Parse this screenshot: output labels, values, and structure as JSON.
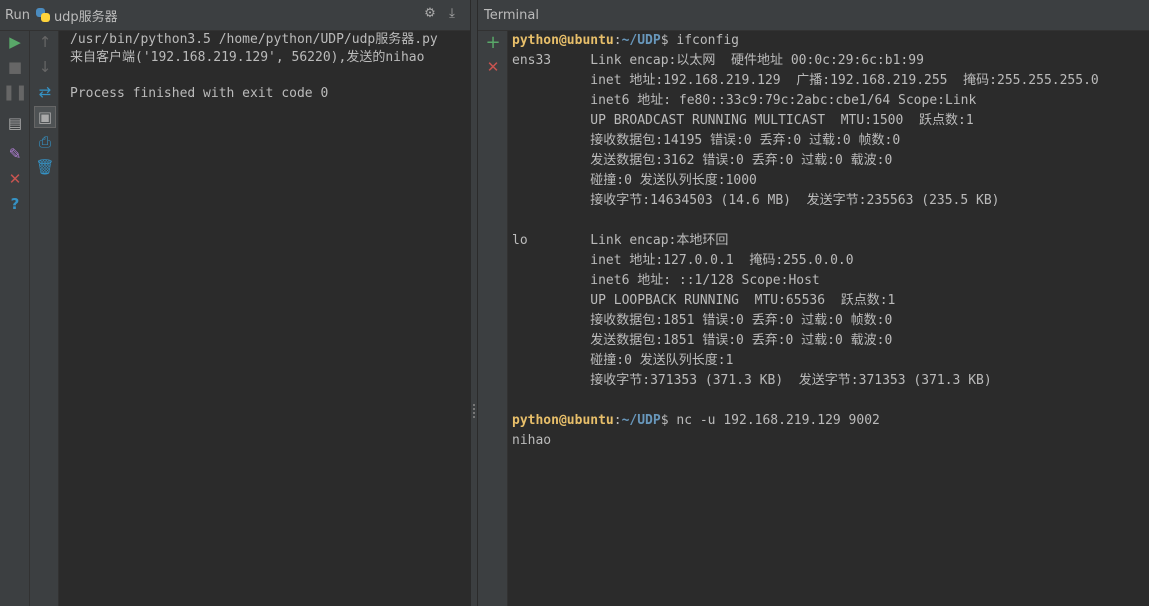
{
  "run_panel": {
    "title": "Run",
    "tab_name": "udp服务器",
    "header_icons": [
      "gear-icon",
      "hide-icon"
    ],
    "output_lines": [
      "/usr/bin/python3.5 /home/python/UDP/udp服务器.py",
      "来自客户端('192.168.219.129', 56220),发送的nihao",
      "",
      "Process finished with exit code 0"
    ],
    "left_toolbar": [
      "run-icon",
      "stop-icon",
      "pause-icon",
      "layout-icon",
      "pin-icon",
      "close-icon",
      "help-icon"
    ],
    "right_toolbar": [
      "up-arrow-icon",
      "down-arrow-icon",
      "soft-wrap-icon",
      "scroll-to-end-icon",
      "print-icon",
      "trash-icon"
    ]
  },
  "terminal": {
    "title": "Terminal",
    "toolbar": [
      "add-icon",
      "close-icon"
    ],
    "prompt1": {
      "user": "python@ubuntu",
      "sep": ":",
      "path": "~/UDP",
      "symbol": "$ ",
      "command": "ifconfig"
    },
    "ifconfig_lines": [
      "ens33     Link encap:以太网  硬件地址 00:0c:29:6c:b1:99",
      "          inet 地址:192.168.219.129  广播:192.168.219.255  掩码:255.255.255.0",
      "          inet6 地址: fe80::33c9:79c:2abc:cbe1/64 Scope:Link",
      "          UP BROADCAST RUNNING MULTICAST  MTU:1500  跃点数:1",
      "          接收数据包:14195 错误:0 丢弃:0 过载:0 帧数:0",
      "          发送数据包:3162 错误:0 丢弃:0 过载:0 载波:0",
      "          碰撞:0 发送队列长度:1000",
      "          接收字节:14634503 (14.6 MB)  发送字节:235563 (235.5 KB)",
      "",
      "lo        Link encap:本地环回",
      "          inet 地址:127.0.0.1  掩码:255.0.0.0",
      "          inet6 地址: ::1/128 Scope:Host",
      "          UP LOOPBACK RUNNING  MTU:65536  跃点数:1",
      "          接收数据包:1851 错误:0 丢弃:0 过载:0 帧数:0",
      "          发送数据包:1851 错误:0 丢弃:0 过载:0 载波:0",
      "          碰撞:0 发送队列长度:1",
      "          接收字节:371353 (371.3 KB)  发送字节:371353 (371.3 KB)",
      ""
    ],
    "prompt2": {
      "user": "python@ubuntu",
      "sep": ":",
      "path": "~/UDP",
      "symbol": "$ ",
      "command": "nc -u 192.168.219.129 9002"
    },
    "after_lines": [
      "nihao"
    ]
  }
}
